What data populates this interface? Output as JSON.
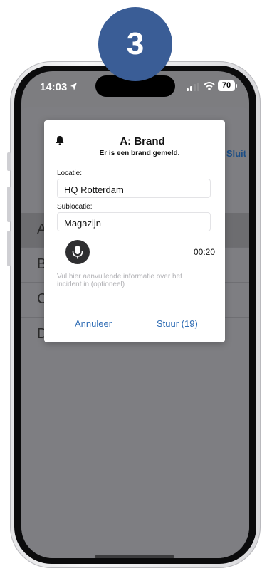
{
  "step_badge": "3",
  "status_bar": {
    "time": "14:03",
    "battery": "70"
  },
  "sheet": {
    "close_label": "Sluit",
    "rows": [
      "A",
      "B",
      "C",
      "D"
    ]
  },
  "dialog": {
    "title": "A: Brand",
    "subtitle": "Er is een brand gemeld.",
    "location_label": "Locatie:",
    "location_value": "HQ Rotterdam",
    "sublocation_label": "Sublocatie:",
    "sublocation_value": "Magazijn",
    "timer": "00:20",
    "hint": "Vul hier aanvullende informatie over het incident in (optioneel)",
    "cancel_label": "Annuleer",
    "send_label": "Stuur (19)"
  },
  "colors": {
    "badge": "#3a5d96",
    "accent": "#2f6db5",
    "overlay": "#7d7d80"
  },
  "icons": {
    "bell": "bell-icon",
    "mic": "microphone-icon",
    "location": "location-arrow-icon",
    "signal": "signal-icon",
    "wifi": "wifi-icon"
  }
}
